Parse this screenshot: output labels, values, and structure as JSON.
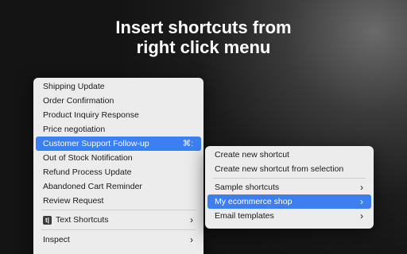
{
  "headline": {
    "line1": "Insert shortcuts from",
    "line2": "right click menu"
  },
  "main_menu": {
    "items": [
      {
        "label": "Shipping Update"
      },
      {
        "label": "Order Confirmation"
      },
      {
        "label": "Product Inquiry Response"
      },
      {
        "label": "Price negotiation"
      },
      {
        "label": "Customer Support Follow-up",
        "shortcut": "⌘:",
        "highlighted": true
      },
      {
        "label": "Out of Stock Notification"
      },
      {
        "label": "Refund Process Update"
      },
      {
        "label": "Abandoned Cart Reminder"
      },
      {
        "label": "Review Request"
      }
    ],
    "text_shortcuts": {
      "label": "Text Shortcuts",
      "icon": "text-shortcuts-app-icon",
      "icon_glyph": "t|"
    },
    "inspect": {
      "label": "Inspect"
    }
  },
  "sub_menu": {
    "items": [
      {
        "label": "Create new shortcut"
      },
      {
        "label": "Create new shortcut from selection"
      },
      {
        "label": "Sample shortcuts",
        "submenu": true
      },
      {
        "label": "My ecommerce shop",
        "submenu": true,
        "highlighted": true
      },
      {
        "label": "Email templates",
        "submenu": true
      }
    ]
  },
  "colors": {
    "highlight": "#3d7ff3",
    "menu_background": "#ececec",
    "headline_text": "#ffffff"
  },
  "chevron_glyph": "›"
}
